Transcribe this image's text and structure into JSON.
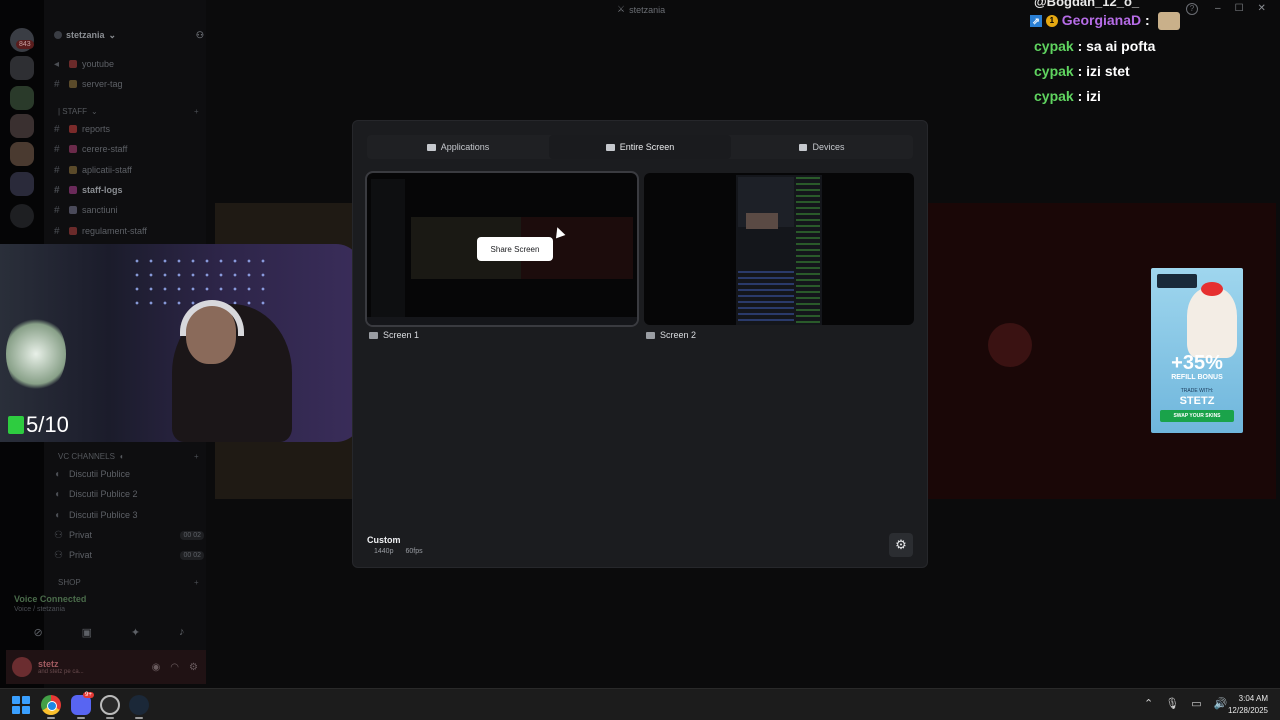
{
  "discord": {
    "rail_badge": "843",
    "server_name": "stetzania",
    "window_title": "stetzania",
    "channels_top": [
      {
        "name": "youtube",
        "color": "#6b2a2a"
      },
      {
        "name": "server-tag",
        "color": "#5a4a2a"
      }
    ],
    "staff_category": "| STAFF",
    "staff_channels": [
      {
        "name": "reports",
        "color": "#7a2a2a",
        "bold": false
      },
      {
        "name": "cerere-staff",
        "color": "#6a2a4a",
        "bold": false
      },
      {
        "name": "aplicatii-staff",
        "color": "#5a4a2a",
        "bold": false
      },
      {
        "name": "staff-logs",
        "color": "#6a2a5a",
        "bold": true
      },
      {
        "name": "sanctiuni",
        "color": "#4a4a5a",
        "bold": false
      },
      {
        "name": "regulament-staff",
        "color": "#6a2a2a",
        "bold": false
      }
    ],
    "vc_category": "VC CHANNELS",
    "vc_channels": [
      {
        "name": "Discutii Publice",
        "pill": ""
      },
      {
        "name": "Discutii Publice 2",
        "pill": ""
      },
      {
        "name": "Discutii Publice 3",
        "pill": ""
      },
      {
        "name": "Privat",
        "pill": "00 02"
      },
      {
        "name": "Privat",
        "pill": "00 02"
      }
    ],
    "shop_category": "SHOP",
    "voice_status": "Voice Connected",
    "voice_sub": "Voice / stetzania",
    "user_name": "stetz",
    "user_status": "and stetz pe ca..."
  },
  "webcam": {
    "counter": "5/10"
  },
  "chat": {
    "top_line": "@Bogdan_12_o_",
    "messages": [
      {
        "user": "GeorgianaD",
        "text": ":",
        "color": "purple",
        "badges": true,
        "emote": true
      },
      {
        "user": "cypak",
        "text": ": sa ai pofta",
        "color": "green",
        "badges": false,
        "emote": false
      },
      {
        "user": "cypak",
        "text": ": izi stet",
        "color": "green",
        "badges": false,
        "emote": false
      },
      {
        "user": "cypak",
        "text": ": izi",
        "color": "green",
        "badges": false,
        "emote": false
      }
    ],
    "badge_square": "⇗",
    "badge_circle": "1"
  },
  "ad": {
    "percent": "+35%",
    "refill": "REFILL BONUS",
    "trade": "TRADE WITH:",
    "brand": "STETZ",
    "cta": "SWAP YOUR SKINS"
  },
  "modal": {
    "tabs": [
      {
        "label": "Applications",
        "active": false,
        "icon": "window-icon"
      },
      {
        "label": "Entire Screen",
        "active": true,
        "icon": "monitor-icon"
      },
      {
        "label": "Devices",
        "active": false,
        "icon": "camera-icon"
      }
    ],
    "share_button": "Share Screen",
    "screens": [
      {
        "label": "Screen 1"
      },
      {
        "label": "Screen 2"
      }
    ],
    "quality_title": "Custom",
    "resolution": "1440p",
    "fps": "60fps",
    "settings_icon": "gear-icon"
  },
  "taskbar": {
    "discord_badge": "9+",
    "time": "3:04 AM",
    "date": "12/28/2025"
  },
  "colors": {
    "accent_green": "#5fd35f",
    "accent_purple": "#b66ce6",
    "modal_bg": "#1b1c1f",
    "button_white": "#ffffff"
  }
}
